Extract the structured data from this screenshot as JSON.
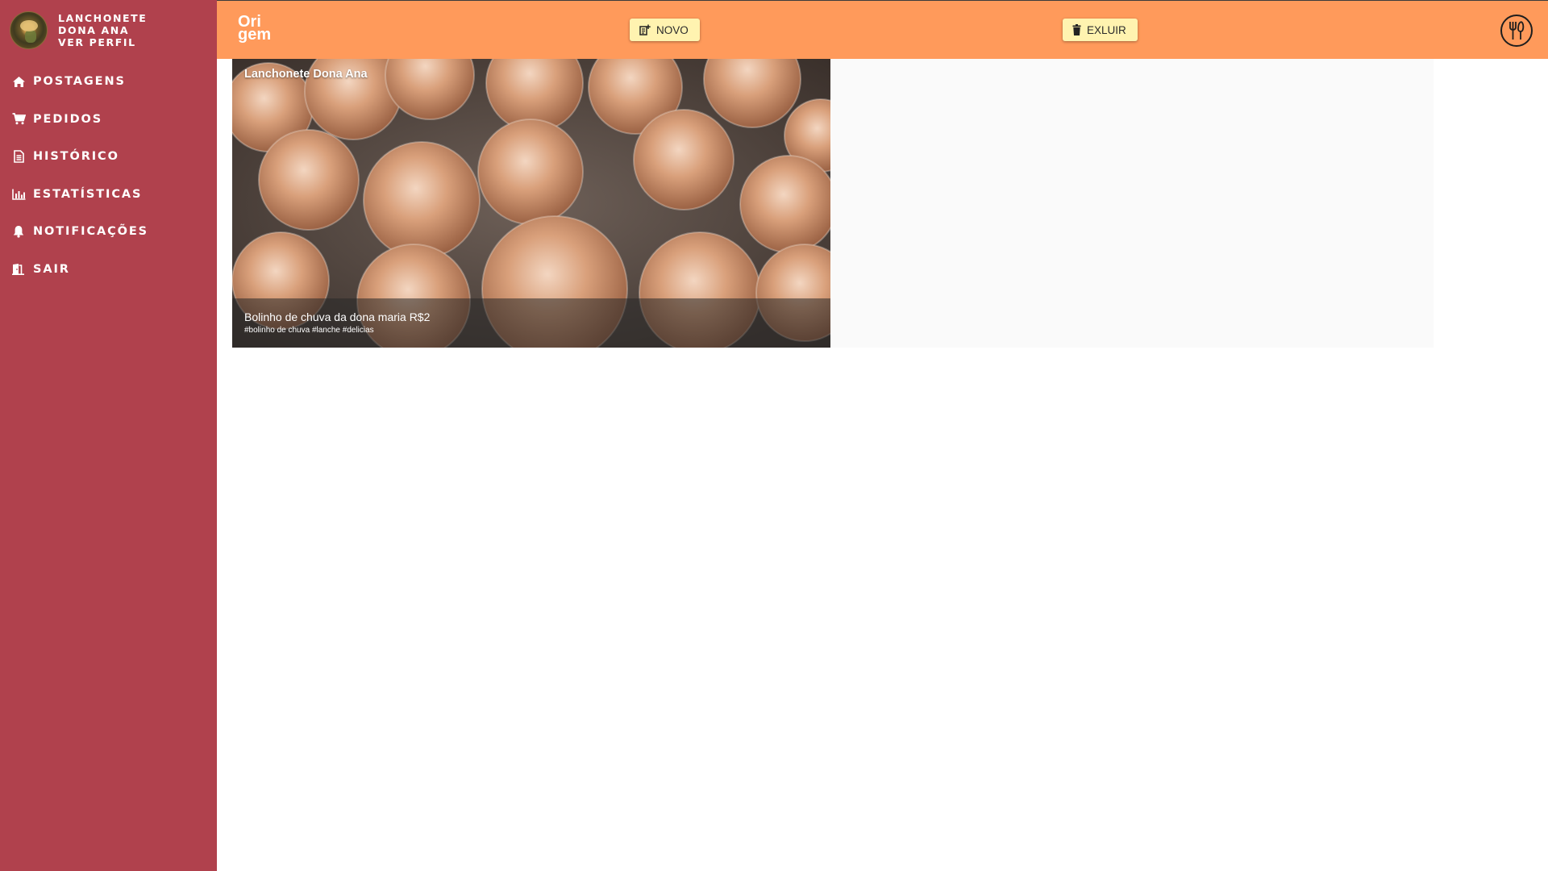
{
  "sidebar": {
    "profile_name": "LANCHONETE DONA ANA",
    "profile_link": "VER PERFIL",
    "items": [
      {
        "label": "POSTAGENS",
        "icon": "home-icon"
      },
      {
        "label": "PEDIDOS",
        "icon": "cart-icon"
      },
      {
        "label": "HISTÓRICO",
        "icon": "document-icon"
      },
      {
        "label": "ESTATÍSTICAS",
        "icon": "bar-chart-icon"
      },
      {
        "label": "NOTIFICAÇÕES",
        "icon": "bell-icon"
      },
      {
        "label": "SAIR",
        "icon": "exit-door-icon"
      }
    ]
  },
  "header": {
    "logo_line1": "Ori",
    "logo_line2": "gem",
    "novo_label": "NOVO",
    "excluir_label": "EXLUIR",
    "right_icon": "utensils-icon"
  },
  "post": {
    "author": "Lanchonete Dona Ana",
    "caption": "Bolinho de chuva da dona maria R$2",
    "hashtags": "#bolinho de chuva #lanche #delicias"
  },
  "colors": {
    "sidebar": "#b0414d",
    "header": "#ff9a5b",
    "button": "#fff3b0"
  }
}
